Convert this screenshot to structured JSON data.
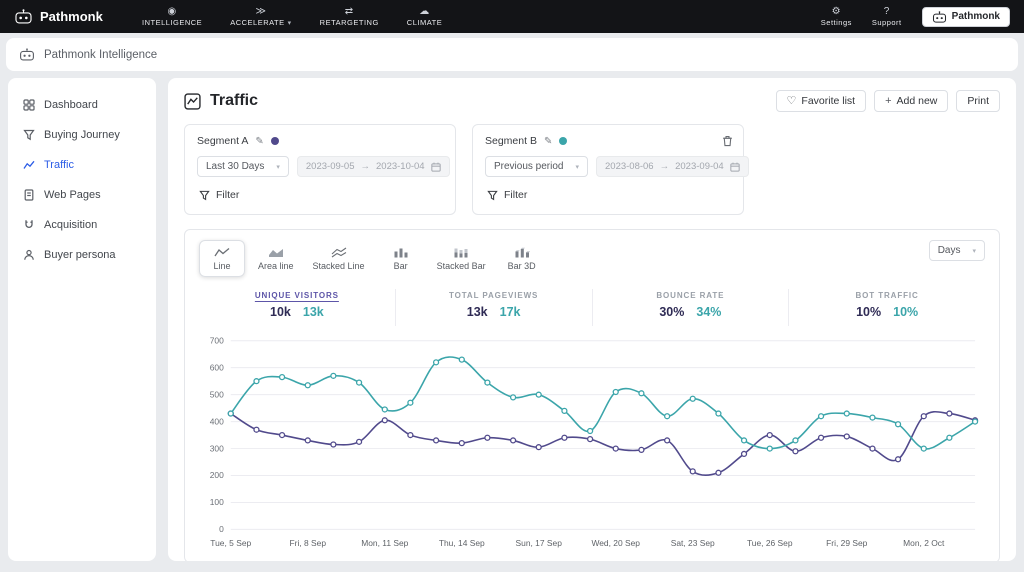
{
  "brand": {
    "name": "Pathmonk"
  },
  "icons": {
    "chevron_down": "▾",
    "arrow_right": "→",
    "heart": "♡",
    "plus": "+",
    "pencil": "✎",
    "gear": "⚙",
    "question": "?",
    "intelligence": "◉",
    "accelerate": "≫",
    "retargeting": "⇄",
    "climate": "☁"
  },
  "topnav": {
    "items": [
      {
        "label": "INTELLIGENCE"
      },
      {
        "label": "ACCELERATE"
      },
      {
        "label": "RETARGETING"
      },
      {
        "label": "CLIMATE"
      }
    ],
    "settings": "Settings",
    "support": "Support",
    "account": "Pathmonk"
  },
  "subheader": {
    "title": "Pathmonk Intelligence"
  },
  "sidebar": {
    "items": [
      {
        "label": "Dashboard"
      },
      {
        "label": "Buying Journey"
      },
      {
        "label": "Traffic"
      },
      {
        "label": "Web Pages"
      },
      {
        "label": "Acquisition"
      },
      {
        "label": "Buyer persona"
      }
    ]
  },
  "page": {
    "title": "Traffic",
    "favorite_label": "Favorite list",
    "add_label": "Add new",
    "print_label": "Print"
  },
  "segments": {
    "a": {
      "name": "Segment A",
      "color": "#514a8c",
      "range_label": "Last 30 Days",
      "start": "2023-09-05",
      "end": "2023-10-04",
      "filter_label": "Filter"
    },
    "b": {
      "name": "Segment B",
      "color": "#3ba5aa",
      "range_label": "Previous period",
      "start": "2023-08-06",
      "end": "2023-09-04",
      "filter_label": "Filter"
    }
  },
  "chart_tabs": [
    {
      "label": "Line"
    },
    {
      "label": "Area line"
    },
    {
      "label": "Stacked Line"
    },
    {
      "label": "Bar"
    },
    {
      "label": "Stacked Bar"
    },
    {
      "label": "Bar 3D"
    }
  ],
  "granularity": {
    "value": "Days"
  },
  "stats": [
    {
      "label": "UNIQUE VISITORS",
      "value_a": "10k",
      "value_b": "13k"
    },
    {
      "label": "TOTAL PAGEVIEWS",
      "value_a": "13k",
      "value_b": "17k"
    },
    {
      "label": "BOUNCE RATE",
      "value_a": "30%",
      "value_b": "34%"
    },
    {
      "label": "BOT TRAFFIC",
      "value_a": "10%",
      "value_b": "10%"
    }
  ],
  "chart_data": {
    "type": "line",
    "n_points": 30,
    "x_tick_indices": [
      0,
      3,
      6,
      9,
      12,
      15,
      18,
      21,
      24,
      27
    ],
    "x_tick_labels": [
      "Tue, 5 Sep",
      "Fri, 8 Sep",
      "Mon, 11 Sep",
      "Thu, 14 Sep",
      "Sun, 17 Sep",
      "Wed, 20 Sep",
      "Sat, 23 Sep",
      "Tue, 26 Sep",
      "Fri, 29 Sep",
      "Mon, 2 Oct"
    ],
    "ylim": [
      0,
      700
    ],
    "y_ticks": [
      0,
      100,
      200,
      300,
      400,
      500,
      600,
      700
    ],
    "grid": true,
    "legend_position": "none",
    "series": [
      {
        "name": "Segment A",
        "color": "#514a8c",
        "values": [
          430,
          370,
          350,
          330,
          315,
          325,
          405,
          350,
          330,
          320,
          340,
          330,
          305,
          340,
          335,
          300,
          295,
          330,
          215,
          210,
          280,
          350,
          290,
          340,
          345,
          300,
          260,
          420,
          430,
          405
        ]
      },
      {
        "name": "Segment B",
        "color": "#3ba5aa",
        "values": [
          430,
          550,
          565,
          535,
          570,
          545,
          445,
          470,
          620,
          630,
          545,
          490,
          500,
          440,
          365,
          510,
          505,
          420,
          485,
          430,
          330,
          300,
          330,
          420,
          430,
          415,
          390,
          300,
          340,
          400
        ]
      }
    ]
  }
}
